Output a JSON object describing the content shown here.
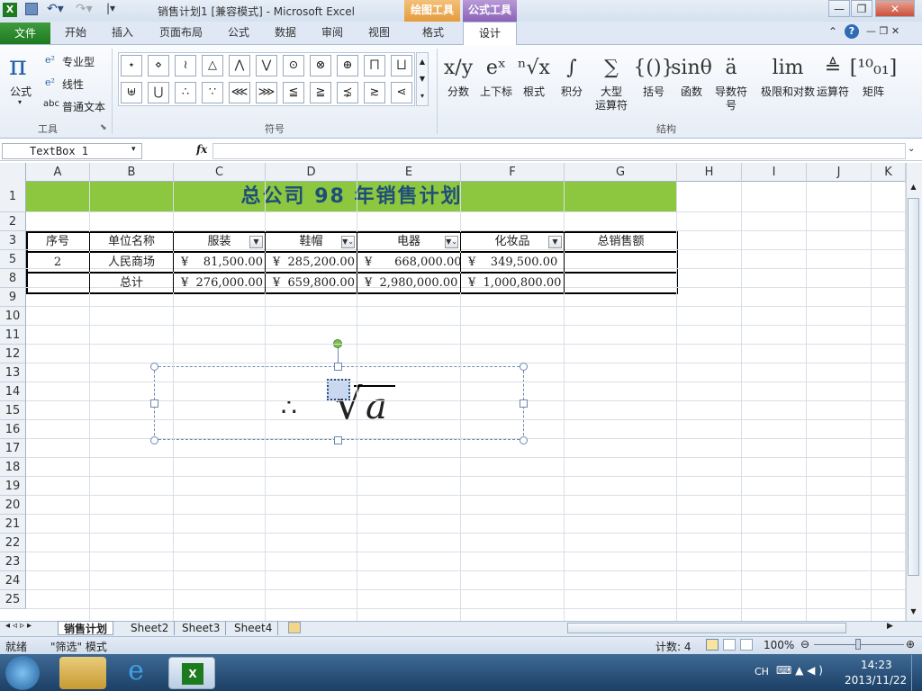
{
  "window": {
    "title": "销售计划1  [兼容模式]  -  Microsoft Excel",
    "context_tab_drawing": "绘图工具",
    "context_tab_equation": "公式工具"
  },
  "tabs": [
    "文件",
    "开始",
    "插入",
    "页面布局",
    "公式",
    "数据",
    "审阅",
    "视图",
    "格式",
    "设计"
  ],
  "ribbon": {
    "tools": {
      "formula_label": "公式",
      "professional": "专业型",
      "linear": "线性",
      "normal_text": "普通文本",
      "group_label": "工具"
    },
    "symbols": {
      "group_label": "符号",
      "row1": [
        "⋆",
        "⋄",
        "≀",
        "△",
        "⋀",
        "⋁",
        "⊙",
        "⊗",
        "⊕",
        "⨅",
        "⨆"
      ],
      "row2": [
        "⊎",
        "⋃",
        "∴",
        "∵",
        "⋘",
        "⋙",
        "≦",
        "≧",
        "⋨",
        "≳",
        "⋖"
      ]
    },
    "structures": {
      "group_label": "结构",
      "items": [
        {
          "label": "分数",
          "glyph": "x/y"
        },
        {
          "label": "上下标",
          "glyph": "eˣ"
        },
        {
          "label": "根式",
          "glyph": "ⁿ√x"
        },
        {
          "label": "积分",
          "glyph": "∫"
        },
        {
          "label": "大型\n运算符",
          "glyph": "∑"
        },
        {
          "label": "括号",
          "glyph": "{()}"
        },
        {
          "label": "函数",
          "glyph": "sinθ"
        },
        {
          "label": "导数符号",
          "glyph": "ä"
        },
        {
          "label": "极限和对数",
          "glyph": "lim"
        },
        {
          "label": "运算符",
          "glyph": "≜"
        },
        {
          "label": "矩阵",
          "glyph": "[¹⁰₀₁]"
        }
      ]
    }
  },
  "formula_bar": {
    "name_box": "TextBox 1",
    "fx": "fx"
  },
  "columns": [
    "A",
    "B",
    "C",
    "D",
    "E",
    "F",
    "G",
    "H",
    "I",
    "J",
    "K"
  ],
  "rows": [
    "1",
    "2",
    "3",
    "5",
    "8",
    "9",
    "10",
    "11",
    "12",
    "13",
    "14",
    "15",
    "16",
    "17",
    "18",
    "19",
    "20",
    "21",
    "22",
    "23",
    "24",
    "25"
  ],
  "sheet": {
    "banner": "总公司 98 年销售计划",
    "header": [
      "序号",
      "单位名称",
      "服装",
      "鞋帽",
      "电器",
      "化妆品",
      "总销售额"
    ],
    "row5": [
      "2",
      "人民商场",
      "¥    81,500.00",
      "¥  285,200.00",
      "¥      668,000.00",
      "¥    349,500.00",
      ""
    ],
    "row8": [
      "",
      "总计",
      "¥  276,000.00",
      "¥  659,800.00",
      "¥  2,980,000.00",
      "¥  1,000,800.00",
      ""
    ]
  },
  "equation": {
    "therefore": "∴",
    "radicand": "a"
  },
  "sheet_tabs": [
    "销售计划",
    "Sheet2",
    "Sheet3",
    "Sheet4"
  ],
  "status": {
    "ready": "就绪",
    "mode": "\"筛选\" 模式",
    "count": "计数: 4",
    "zoom": "100%"
  },
  "taskbar": {
    "lang": "CH",
    "time": "14:23",
    "date": "2013/11/22"
  }
}
